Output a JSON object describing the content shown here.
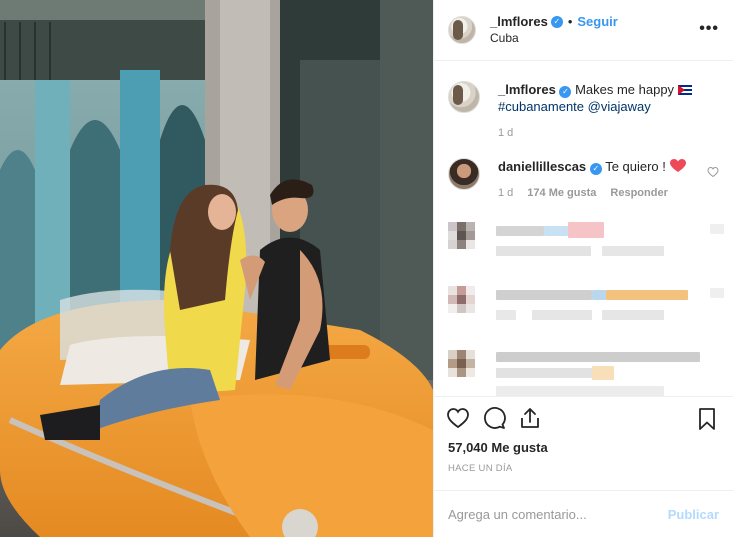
{
  "post": {
    "author": {
      "username": "_lmflores",
      "verified": true,
      "follow_label": "Seguir",
      "location": "Cuba"
    },
    "caption": {
      "username": "_lmflores",
      "text": "Makes me happy",
      "flag_icon": "cuba-flag-icon",
      "hashtag": "#cubanamente",
      "mention": "@viajaway",
      "time": "1 d"
    },
    "comments": [
      {
        "username": "daniellillescas",
        "verified": true,
        "text": "Te quiero !",
        "emoji": "red-heart-emoji",
        "time": "1 d",
        "likes": "174 Me gusta",
        "reply_label": "Responder"
      }
    ],
    "likes": "57,040 Me gusta",
    "posted": "HACE UN DÍA",
    "comment_input": {
      "placeholder": "Agrega un comentario...",
      "publish_label": "Publicar"
    }
  },
  "colors": {
    "accent": "#3897f0",
    "publish_disabled": "#b3dbff",
    "muted": "#999999",
    "heart": "#ed4956"
  }
}
